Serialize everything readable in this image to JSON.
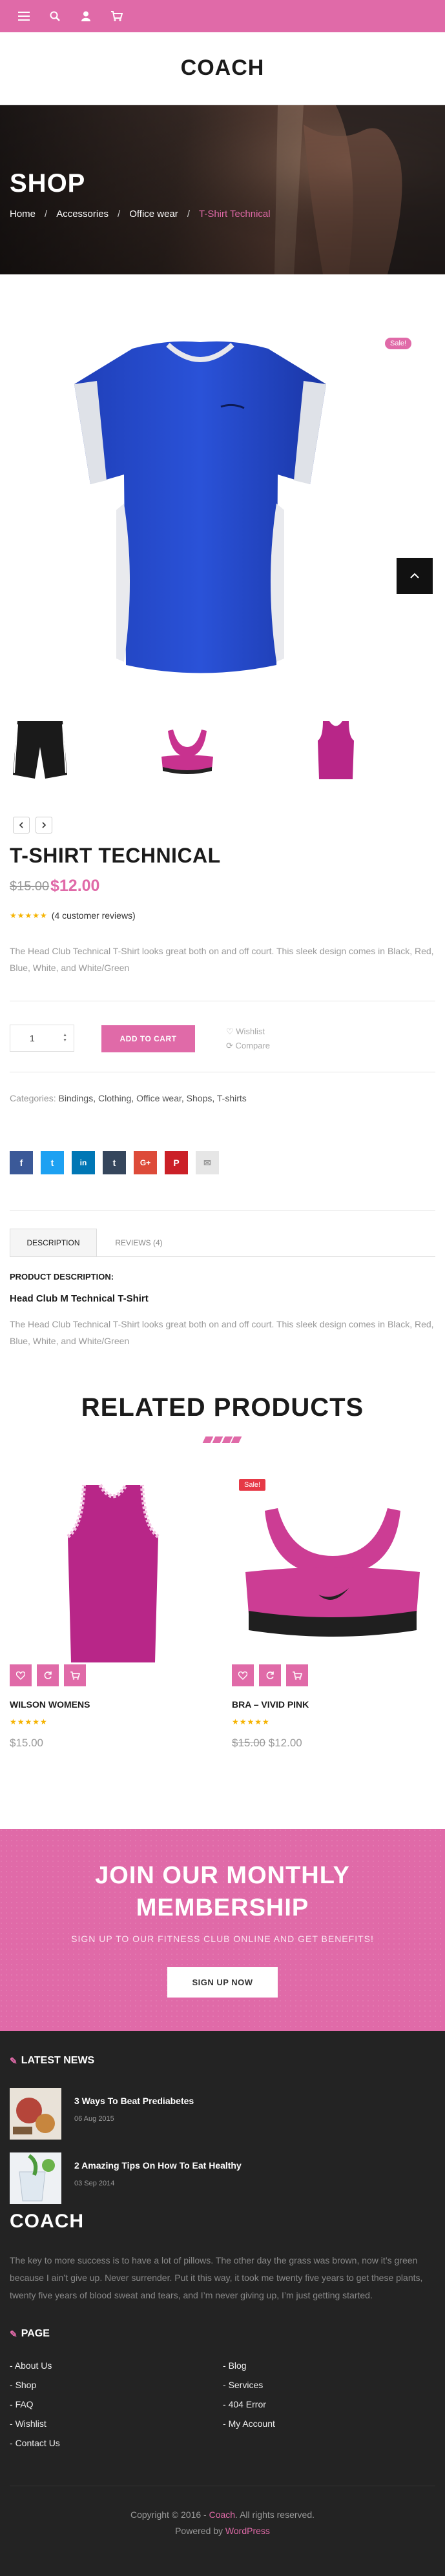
{
  "brand": {
    "logo_text": "COACH",
    "accent": "#e06aa8"
  },
  "topbar": {
    "icons": [
      "menu-icon",
      "search-icon",
      "user-icon",
      "cart-icon"
    ]
  },
  "hero": {
    "title": "SHOP",
    "breadcrumbs": [
      "Home",
      "Accessories",
      "Office wear",
      "T-Shirt Technical"
    ]
  },
  "product": {
    "sale_badge": "Sale!",
    "title": "T-SHIRT TECHNICAL",
    "price_old": "$15.00",
    "price_new": "$12.00",
    "reviews_text": "(4 customer reviews)",
    "short_description": "The Head Club Technical T-Shirt looks great both on and off court. This sleek design comes in Black, Red, Blue, White, and White/Green",
    "quantity": "1",
    "add_to_cart": "ADD TO CART",
    "wishlist": "Wishlist",
    "compare": "Compare",
    "categories_label": "Categories:",
    "categories": "Bindings, Clothing, Office wear, Shops, T-shirts"
  },
  "tabs": {
    "description": "DESCRIPTION",
    "reviews": "REVIEWS (4)"
  },
  "description": {
    "heading": "PRODUCT DESCRIPTION:",
    "subheading": "Head Club M Technical T-Shirt",
    "text": "The Head Club Technical T-Shirt looks great both on and off court. This sleek design comes in Black, Red, Blue, White, and White/Green"
  },
  "related": {
    "title": "RELATED PRODUCTS",
    "items": [
      {
        "name": "WILSON WOMENS",
        "price": "$15.00",
        "price_old": "",
        "sale": ""
      },
      {
        "name": "BRA – VIVID PINK",
        "price": "$12.00",
        "price_old": "$15.00",
        "sale": "Sale!"
      }
    ]
  },
  "membership": {
    "title_line1": "JOIN OUR MONTHLY",
    "title_line2": "MEMBERSHIP",
    "subtitle": "SIGN UP TO OUR FITNESS CLUB ONLINE AND GET BENEFITS!",
    "button": "SIGN UP NOW"
  },
  "footer": {
    "latest_news_heading": "LATEST NEWS",
    "news": [
      {
        "title": "3 Ways To Beat Prediabetes",
        "date": "06 Aug 2015"
      },
      {
        "title": "2 Amazing Tips On How To Eat Healthy",
        "date": "03 Sep 2014"
      }
    ],
    "logo_text": "COACH",
    "about_text": "The key to more success is to have a lot of pillows. The other day the grass was brown, now it’s green because I ain’t give up. Never surrender. Put it this way, it took me twenty five years to get these plants, twenty five years of blood sweat and tears, and I’m never giving up, I’m just getting started.",
    "page_heading": "PAGE",
    "links_left": [
      "About Us",
      "Shop",
      "FAQ",
      "Wishlist",
      "Contact Us"
    ],
    "links_right": [
      "Blog",
      "Services",
      "404 Error",
      "My Account"
    ],
    "copyright_prefix": "Copyright © 2016 -",
    "copyright_brand": "Coach",
    "copyright_suffix": ". All rights reserved.",
    "powered_prefix": "Powered by",
    "powered_brand": "WordPress"
  }
}
